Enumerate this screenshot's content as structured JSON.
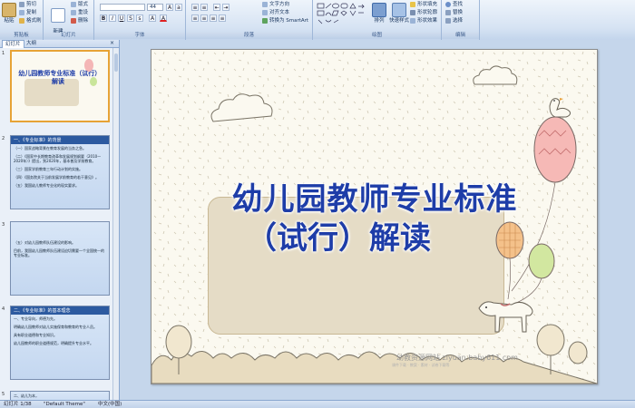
{
  "ribbon": {
    "clipboard": {
      "paste": "粘贴",
      "cut": "剪切",
      "copy": "复制",
      "format_painter": "格式刷",
      "title": "剪贴板"
    },
    "slides": {
      "new_slide": "新建\n幻灯片",
      "layout": "版式",
      "reset": "重设",
      "delete": "删除",
      "title": "幻灯片"
    },
    "font": {
      "font_name": "",
      "font_size": "44",
      "title": "字体"
    },
    "paragraph": {
      "text_direction": "文字方向",
      "align_text": "对齐文本",
      "smartart": "转换为 SmartArt",
      "title": "段落"
    },
    "drawing": {
      "arrange": "排列",
      "quick_styles": "快速样式",
      "shape_fill": "形状填充",
      "shape_outline": "形状轮廓",
      "shape_effects": "形状效果",
      "title": "绘图"
    },
    "editing": {
      "find": "查找",
      "replace": "替换",
      "select": "选择",
      "title": "编辑"
    }
  },
  "left_pane": {
    "tabs": [
      "幻灯片",
      "大纲"
    ],
    "close": "×",
    "slides": [
      {
        "num": "1",
        "title": "幼儿园教师专业标准（试行）解读",
        "lines": []
      },
      {
        "num": "2",
        "title": "一、《专业标准》的背景",
        "lines": [
          "（一）国家战略背景在教育发展的当务之急。",
          "（二）《国家中长期教育改革和发展规划纲要（2010—2020年）》提出，到2020年，基本普及学前教育。",
          "（三）国家学前教育三年行动计划的实施。",
          "（四）《国务院关于当前发展学前教育的若干意见》。",
          "（五）我国幼儿教师专业化的现实要求。"
        ]
      },
      {
        "num": "3",
        "title": "",
        "lines": [
          "（五）对幼儿园教师队伍建设的影响。",
          "目前，我国幼儿园教师队伍建设迫切需要一个全国统一的专业标准。"
        ]
      },
      {
        "num": "4",
        "title": "二、《专业标准》的基本理念",
        "lines": [
          "一、专业导向，师德为先。",
          "明确幼儿园教师对幼儿实施保育和教育的专业人员。",
          "具有职业道德和专业知识。",
          "幼儿园教师的职业道德规范，明确提升专业水平。"
        ]
      },
      {
        "num": "5",
        "title": "二、幼儿为本，",
        "lines": []
      }
    ]
  },
  "slide": {
    "title_line1": "幼儿园教师专业标准",
    "title_line2": "（试行）解读",
    "watermark": "幼教资源网站  ziyuan.baby611.com",
    "watermark_sub": "课件下载 · 教案 · 素材 · 试卷下载等"
  },
  "status_bar": {
    "slide_count": "幻灯片 1/38",
    "theme": "\"Default Theme\"",
    "language": "中文(中国)"
  }
}
